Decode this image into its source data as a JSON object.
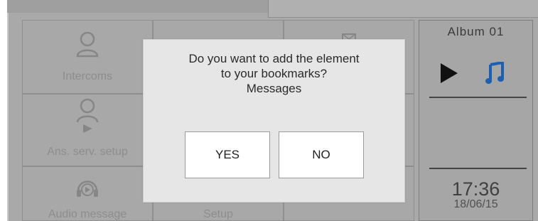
{
  "tiles": {
    "intercoms": {
      "label": "Intercoms",
      "icon": "person-icon"
    },
    "ans_serv_setup": {
      "label": "Ans. serv. setup",
      "icon": "person-play-icon"
    },
    "audio_message": {
      "label": "Audio message",
      "icon": "headset-play-icon"
    },
    "setup": {
      "label": "Setup"
    },
    "messages": {
      "icon": "envelope-icon"
    }
  },
  "media": {
    "album_title": "Album 01",
    "play_icon": "play-icon",
    "music_icon": "music-note-icon",
    "music_color": "#1f5fb0"
  },
  "clock": {
    "time": "17:36",
    "date": "18/06/15"
  },
  "dialog": {
    "line1": "Do you want to add the element",
    "line2": "to your bookmarks?",
    "line3": "Messages",
    "yes_label": "YES",
    "no_label": "NO"
  }
}
